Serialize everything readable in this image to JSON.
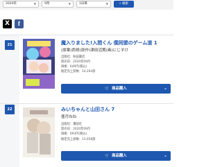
{
  "filters": {
    "year": "2020年",
    "month": "9月",
    "day": "1日目",
    "search_label": "検索"
  },
  "share": {
    "x_label": "X",
    "fb_label": "f"
  },
  "items": [
    {
      "rank": "21",
      "title": "魔入りました!入間くん 僕同盟のゲーム道 1",
      "author": "(原案)西修(原作)津田沼篤(画)にじすけ",
      "publisher": "出版社：秋田書店",
      "release": "発売日：2020年09月",
      "price": "価格：649円(税込)",
      "sales": "推定売上部数：14,264部",
      "buy_label": "商品購入"
    },
    {
      "rank": "22",
      "title": "みいちゃんと山田さん 7",
      "author": "亜月ねね",
      "publisher": "出版社：講談社",
      "release": "発売日：2020年09月",
      "price": "価格：693円(税込)",
      "sales": "推定売上部数：13,958部",
      "buy_label": "商品購入"
    }
  ],
  "colors": {
    "accent": "#1e57b0",
    "x_brand": "#000000",
    "fb_brand": "#3b5998"
  }
}
